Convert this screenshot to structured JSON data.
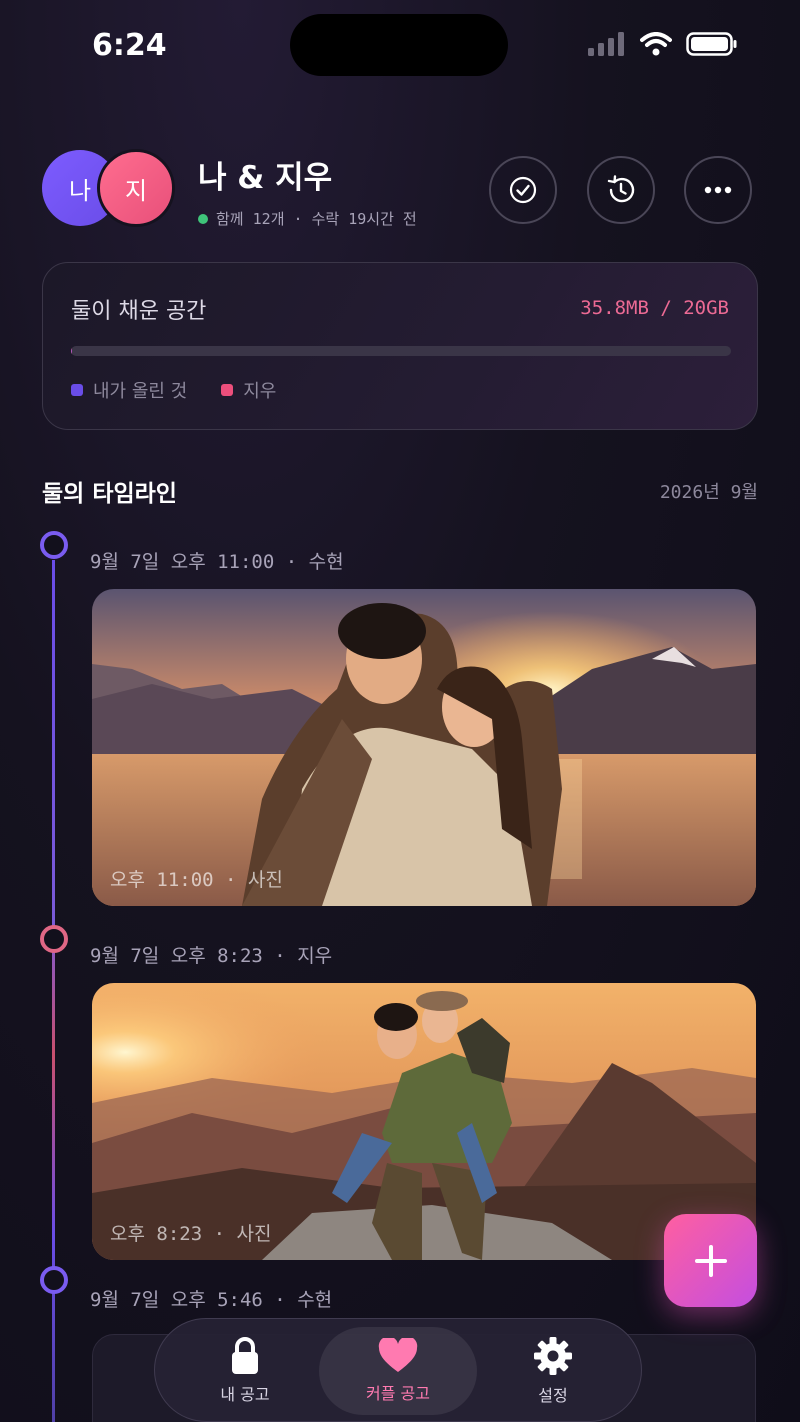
{
  "status_bar": {
    "time": "6:24"
  },
  "header": {
    "avatar_me": "나",
    "avatar_partner": "지",
    "title": "나 & 지우",
    "meta": "함께 12개 · 수락 19시간 전"
  },
  "storage": {
    "title": "둘이 채운 공간",
    "value": "35.8MB / 20GB",
    "used_fraction": 0.002,
    "legend_me": "내가 올린 것",
    "legend_partner": "지우"
  },
  "timeline": {
    "title": "둘의 타임라인",
    "date": "2026년 9월",
    "entries": [
      {
        "meta": "9월 7일 오후 11:00 · 수현",
        "caption": "오후 11:00 · 사진"
      },
      {
        "meta": "9월 7일 오후 8:23 · 지우",
        "caption": "오후 8:23 · 사진"
      },
      {
        "meta": "9월 7일 오후 5:46 · 수현"
      }
    ]
  },
  "nav": {
    "my_space": "내 공고",
    "couple_space": "커플 공고",
    "settings": "설정"
  },
  "colors": {
    "accent_purple": "#7d5cff",
    "accent_pink": "#ec5a8a",
    "online_green": "#3fc47a"
  }
}
